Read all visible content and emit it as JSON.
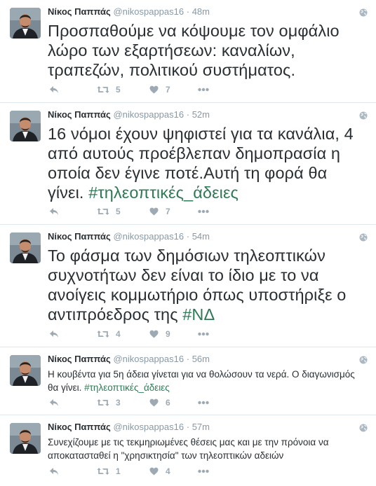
{
  "tweets": [
    {
      "name": "Νίκος Παππάς",
      "handle": "@nikospappas16",
      "time": "48m",
      "text": "Προσπαθούμε να κόψουμε τον ομφάλιο λώρο των εξαρτήσεων: καναλίων, τραπεζών, πολιτικού συστήματος.",
      "retweets": "5",
      "likes": "7"
    },
    {
      "name": "Νίκος Παππάς",
      "handle": "@nikospappas16",
      "time": "52m",
      "text": "16 νόμοι έχουν ψηφιστεί για τα κανάλια, 4 από αυτούς προέβλεπαν δημοπρασία η οποία δεν έγινε ποτέ.Αυτή τη φορά θα γίνει. ",
      "hashtag": "#τηλεοπτικές_άδειες",
      "retweets": "5",
      "likes": "7"
    },
    {
      "name": "Νίκος Παππάς",
      "handle": "@nikospappas16",
      "time": "54m",
      "text": "Το φάσμα των δημόσιων τηλεοπτικών συχνοτήτων δεν είναι το ίδιο με το να ανοίγεις κομμωτήριο όπως υποστήριξε ο αντιπρόεδρος της ",
      "hashtag": "#ΝΔ",
      "retweets": "4",
      "likes": "9"
    },
    {
      "name": "Νίκος Παππάς",
      "handle": "@nikospappas16",
      "time": "56m",
      "text": "Η κουβέντα για 5η άδεια γίνεται για να θολώσουν τα νερά. Ο διαγωνισμός θα γίνει.  ",
      "hashtag": "#τηλεοπτικές_άδειες",
      "retweets": "3",
      "likes": "6"
    },
    {
      "name": "Νίκος Παππάς",
      "handle": "@nikospappas16",
      "time": "57m",
      "text": "Συνεχίζουμε με τις τεκμηριωμένες θέσεις μας και με την πρόνοια να αποκατασταθεί η \"χρησικτησία\" των τηλεοπτικών αδειών",
      "retweets": "1",
      "likes": "4"
    }
  ],
  "icons": {
    "reply": "reply-icon",
    "retweet": "retweet-icon",
    "like": "heart-icon",
    "more": "more-icon",
    "globe": "globe-icon"
  },
  "colors": {
    "hashtag": "#2f7a56",
    "meta": "#8899a6",
    "action": "#9eaab3",
    "divider": "#e1e8ed"
  }
}
